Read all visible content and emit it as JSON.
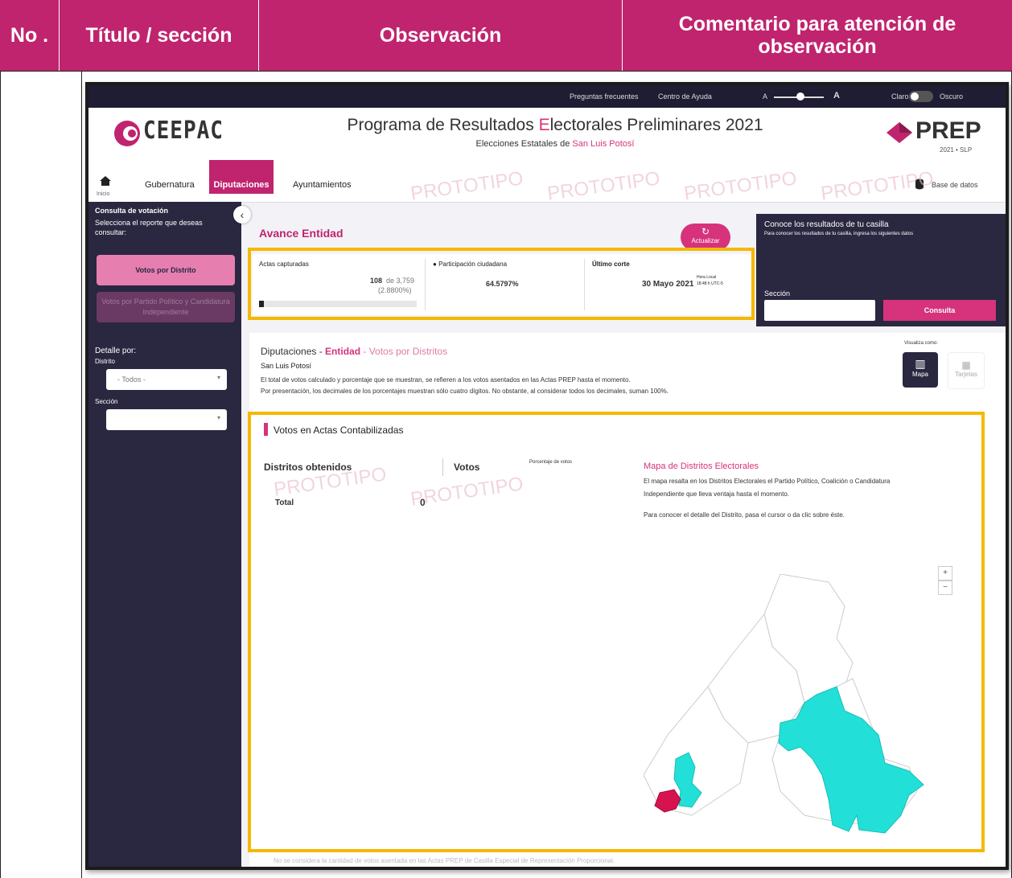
{
  "header": {
    "col_no": "No .",
    "col_titulo": "Título / sección",
    "col_observacion": "Observación",
    "col_comentario": "Comentario para atención de observación"
  },
  "screenshot": {
    "topbar": {
      "faq": "Preguntas frecuentes",
      "help": "Centro de Ayuda",
      "font_small": "A",
      "font_large": "A",
      "theme_light": "Claro",
      "theme_dark": "Oscuro"
    },
    "brand": {
      "logo_text": "CEEPAC",
      "title_part1": "Programa de Resultados ",
      "title_highlight": "E",
      "title_part2": "lectorales Preliminares 2021",
      "subtitle_prefix": "Elecciones Estatales de ",
      "subtitle_state": "San Luis Potosí",
      "prep_logo": "PREP",
      "prep_sub": "2021 • SLP"
    },
    "nav": {
      "home": "Inicio",
      "tabs": [
        "Gubernatura",
        "Diputaciones",
        "Ayuntamientos"
      ],
      "database": "Base de datos",
      "watermark": "PROTOTIPO"
    },
    "sidebar": {
      "title": "Consulta de votación",
      "subtitle": "Selecciona el reporte que deseas consultar:",
      "btn_distrito": "Votos por Distrito",
      "btn_partido": "Votos por Partido Político y Candidatura Independiente",
      "detalle": "Detalle por:",
      "distrito_label": "Distrito",
      "distrito_value": "- Todos -",
      "seccion_label": "Sección"
    },
    "avance": {
      "title": "Avance Entidad",
      "update_btn": "Actualizar",
      "actas_label": "Actas capturadas",
      "actas_value": "108",
      "actas_total": "de 3,759",
      "actas_pct": "(2.8800%)",
      "participacion_label": "Participación ciudadana",
      "participacion_value": "64.5797%",
      "corte_label": "Último corte",
      "corte_value": "30 Mayo 2021",
      "hora_label": "Hora Local",
      "hora_value": "18:48 h UTC-5",
      "progress": 0.0288
    },
    "casilla": {
      "title": "Conoce los resultados de tu casilla",
      "hint": "Para conocer los resultados de tu casilla, ingresa los siguientes datos",
      "seccion_label": "Sección",
      "btn": "Consulta"
    },
    "main": {
      "crumb_1": "Diputaciones - ",
      "crumb_2": "Entidad",
      "crumb_3": " - Votos por Distritos",
      "state": "San Luis Potosí",
      "note1": "El total de votos calculado y porcentaje que se muestran, se refieren a los votos asentados en las Actas PREP hasta el momento.",
      "note2": "Por presentación, los decimales de los porcentajes muestran sólo cuatro dígitos. No obstante, al considerar todos los decimales, suman 100%.",
      "visualiza": "Visualiza como:",
      "btn_mapa": "Mapa",
      "btn_tarjetas": "Tarjetas",
      "section_title": "Votos en Actas Contabilizadas",
      "col_distritos": "Distritos obtenidos",
      "col_votos": "Votos",
      "col_pct": "Porcentaje de votos",
      "total_label": "Total",
      "total_value": "0",
      "map_title": "Mapa de Distritos Electorales",
      "map_desc1": "El mapa resalta en los Distritos Electorales el Partido Político, Coalición o Candidatura",
      "map_desc2": "Independiente que lleva ventaja hasta el momento.",
      "map_desc3": "Para conocer el detalle del Distrito, pasa el cursor o da clic sobre éste.",
      "zoom_in": "+",
      "zoom_out": "−",
      "footer_note": "No se considera la cantidad de votos asentada en las Actas PREP de Casilla Especial de Representación Proporcional."
    },
    "colors": {
      "brand_pink": "#c0246e",
      "highlight": "#f5b800",
      "map_lead": "#22e0d8",
      "map_other": "#d6134f"
    }
  }
}
